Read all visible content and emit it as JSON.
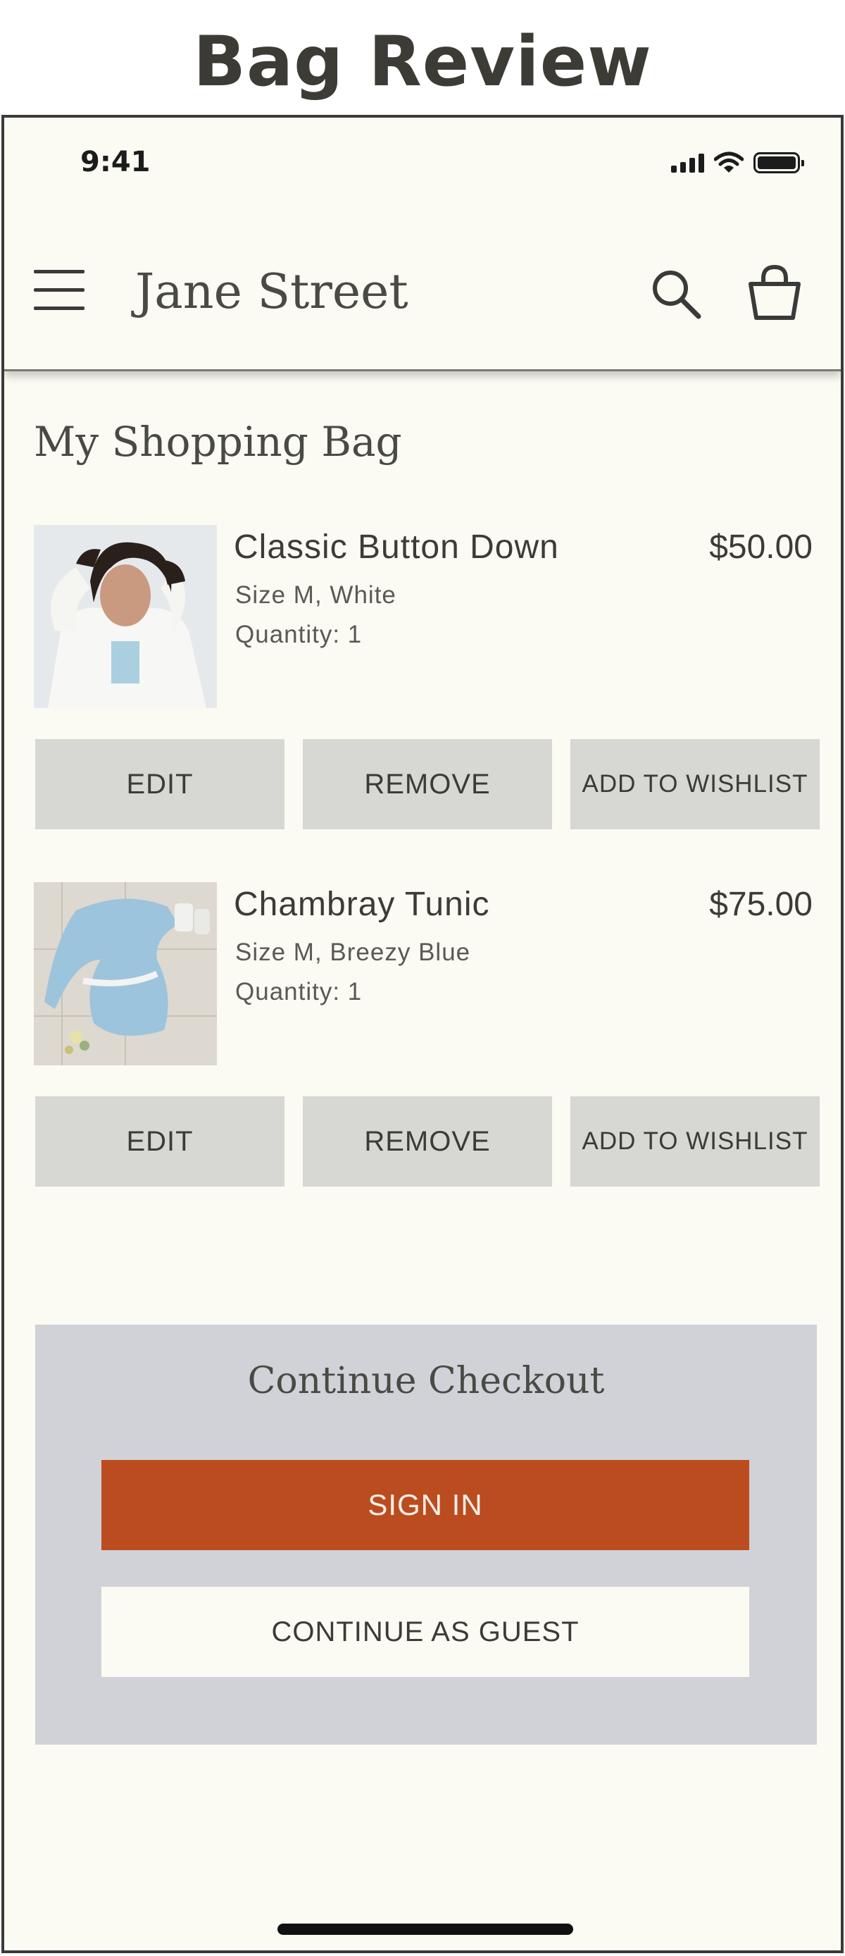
{
  "page": {
    "title": "Bag Review"
  },
  "status_bar": {
    "time": "9:41",
    "icons": [
      "signal-icon",
      "wifi-icon",
      "battery-icon"
    ]
  },
  "header": {
    "brand": "Jane Street",
    "icons": [
      "menu-icon",
      "search-icon",
      "shopping-bag-icon"
    ]
  },
  "bag": {
    "title": "My Shopping Bag",
    "items": [
      {
        "name": "Classic Button Down",
        "price": "$50.00",
        "size_color": "Size M, White",
        "quantity": "Quantity: 1",
        "image": "woman-in-white-shirt-photo"
      },
      {
        "name": "Chambray Tunic",
        "price": "$75.00",
        "size_color": "Size M, Breezy Blue",
        "quantity": "Quantity: 1",
        "image": "blue-tunic-flat-lay-photo"
      }
    ],
    "actions": {
      "edit": "EDIT",
      "remove": "REMOVE",
      "wishlist": "ADD TO WISHLIST"
    }
  },
  "checkout": {
    "title": "Continue Checkout",
    "sign_in": "SIGN IN",
    "guest": "CONTINUE AS GUEST"
  },
  "colors": {
    "background": "#fbfbf3",
    "button_gray": "#d7d7d3",
    "checkout_panel": "#d0d2d8",
    "accent": "#bb4c20",
    "text": "#3d3b36"
  }
}
